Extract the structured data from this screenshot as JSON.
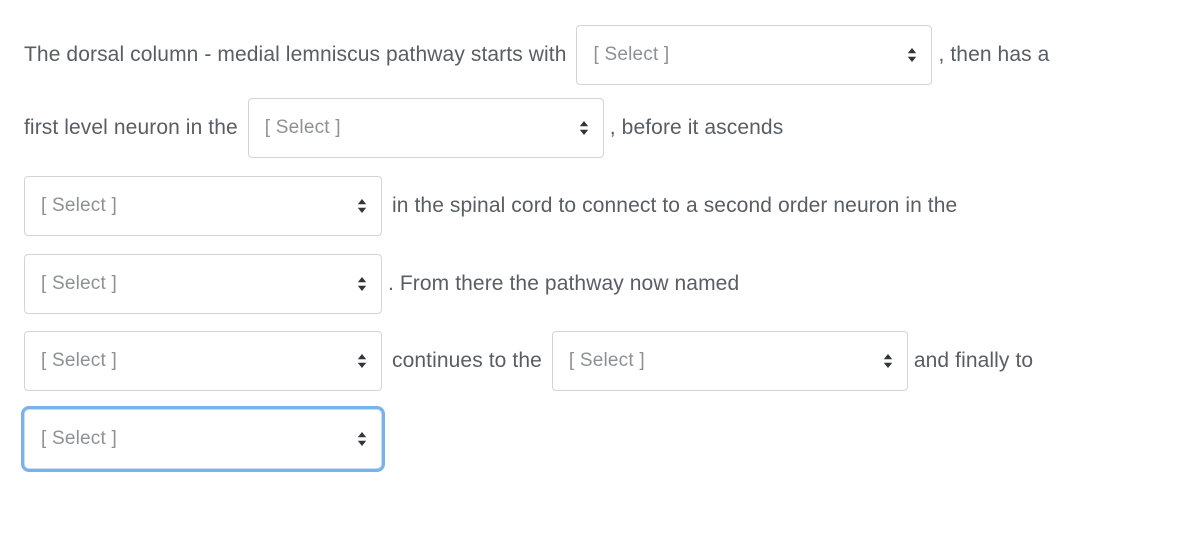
{
  "question": {
    "segments_line1": {
      "before": "The dorsal column - medial lemniscus pathway starts with",
      "after": ",  then has a"
    },
    "segments_line2": {
      "before": "first level neuron in the",
      "after": ", before it ascends"
    },
    "segments_line3": {
      "after": "in the spinal cord to connect to a second order neuron in the"
    },
    "segments_line4": {
      "after": ".  From there the pathway now named"
    },
    "segments_line5": {
      "middle": "continues to the",
      "after": "and finally to"
    }
  },
  "selects": [
    {
      "id": "select-1",
      "value": "[ Select ]",
      "placeholder": "[ Select ]",
      "focused": false
    },
    {
      "id": "select-2",
      "value": "[ Select ]",
      "placeholder": "[ Select ]",
      "focused": false
    },
    {
      "id": "select-3",
      "value": "[ Select ]",
      "placeholder": "[ Select ]",
      "focused": false
    },
    {
      "id": "select-4",
      "value": "[ Select ]",
      "placeholder": "[ Select ]",
      "focused": false
    },
    {
      "id": "select-5",
      "value": "[ Select ]",
      "placeholder": "[ Select ]",
      "focused": false
    },
    {
      "id": "select-6",
      "value": "[ Select ]",
      "placeholder": "[ Select ]",
      "focused": false
    },
    {
      "id": "select-7",
      "value": "[ Select ]",
      "placeholder": "[ Select ]",
      "focused": true
    }
  ],
  "icons": {
    "select_indicator": "chevron-updown-icon"
  },
  "colors": {
    "text": "#585e63",
    "placeholder": "#8d9196",
    "border": "#d2d4d6",
    "focus_ring": "#79b2e8",
    "background": "#ffffff"
  }
}
